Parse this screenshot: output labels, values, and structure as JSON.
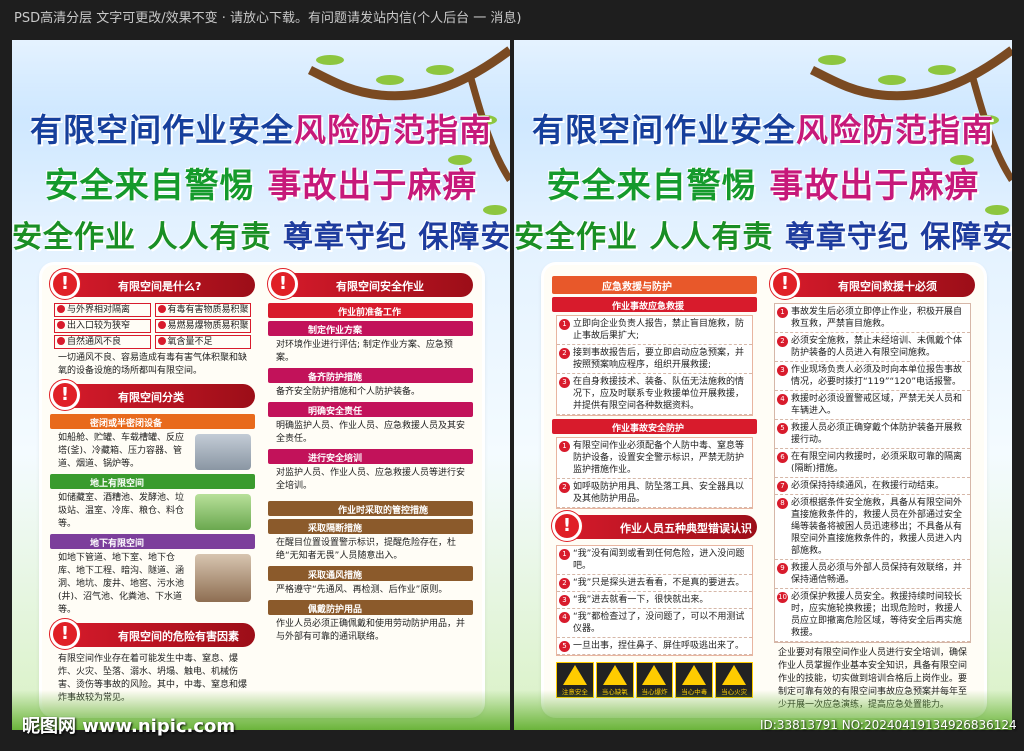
{
  "topbar": "PSD高清分层 文字可更改/效果不变 · 请放心下载。有问题请发站内信(个人后台 一 消息)",
  "headline": {
    "l1a": "有限空间作业安全",
    "l1b": "风险防范指南",
    "l2a": "安全来自警惕",
    "l2b": "事故出于麻痹",
    "l3a": "安全作业 人人有责",
    "l3b": "尊章守纪 保障安全"
  },
  "poster1": {
    "s1": {
      "title": "有限空间是什么?",
      "cells": [
        "与外界相对隔离",
        "有毒有害物质易积聚",
        "出入口较为狭窄",
        "易燃易爆物质易积聚",
        "自然通风不良",
        "氧含量不足"
      ],
      "desc": "一切通风不良、容易造成有毒有害气体积聚和缺氧的设备设施的场所都叫有限空间。"
    },
    "s2": {
      "title": "有限空间分类",
      "sub1": "密闭或半密闭设备",
      "t1": "如船舱、贮罐、车载槽罐、反应塔(釜)、冷藏箱、压力容器、管道、烟道、锅炉等。",
      "sub2": "地上有限空间",
      "t2": "如储藏室、酒糟池、发酵池、垃圾站、温室、冷库、粮仓、料仓等。",
      "sub3": "地下有限空间",
      "t3": "如地下管道、地下室、地下仓库、地下工程、暗沟、隧道、涵洞、地坑、废井、地窖、污水池(井)、沼气池、化粪池、下水道等。"
    },
    "s3": {
      "title": "有限空间的危险有害因素",
      "t": "有限空间作业存在着可能发生中毒、窒息、爆炸、火灾、坠落、溺水、坍塌、触电、机械伤害、烫伤等事故的风险。其中，中毒、窒息和爆炸事故较为常见。"
    },
    "s4": {
      "title": "有限空间安全作业",
      "sub0": "作业前准备工作",
      "sub1": "制定作业方案",
      "t1": "对环境作业进行评估; 制定作业方案、应急预案。",
      "sub2": "备齐防护措施",
      "t2": "备齐安全防护措施和个人防护装备。",
      "sub3": "明确安全责任",
      "t3": "明确监护人员、作业人员、应急救援人员及其安全责任。",
      "sub4": "进行安全培训",
      "t4": "对监护人员、作业人员、应急救援人员等进行安全培训。"
    },
    "s5": {
      "sub0": "作业时采取的管控措施",
      "sub1": "采取隔断措施",
      "t1": "在醒目位置设置警示标识，提醒危险存在，杜绝“无知者无畏”人员随意出入。",
      "sub2": "采取通风措施",
      "t2": "严格遵守“先通风、再检测、后作业”原则。",
      "sub3": "佩戴防护用品",
      "t3": "作业人员必须正确佩戴和使用劳动防护用品，并与外部有可靠的通讯联络。"
    }
  },
  "poster2": {
    "s1": {
      "title": "应急救援与防护",
      "sub1": "作业事故应急救援",
      "items1": [
        "立即向企业负责人报告，禁止盲目施救，防止事故后果扩大;",
        "接到事故报告后，要立即启动应急预案，并按照预案响应程序，组织开展救援;",
        "在自身救援技术、装备、队伍无法施救的情况下，应及时联系专业救援单位开展救援，并提供有限空间各种数据资料。"
      ],
      "sub2": "作业事故安全防护",
      "items2": [
        "有限空间作业必须配备个人防中毒、窒息等防护设备，设置安全警示标识，严禁无防护监护措施作业。",
        "如呼吸防护用具、防坠落工具、安全器具以及其他防护用品。"
      ]
    },
    "s2": {
      "title": "作业人员五种典型错误认识",
      "items": [
        "“我”没有闻到或看到任何危险，进入没问题吧。",
        "“我”只是探头进去看看，不是真的要进去。",
        "“我”进去就看一下，很快就出来。",
        "“我”都检查过了，没问题了，可以不用测试仪器。",
        "一旦出事，捏住鼻子、屏住呼吸逃出来了。"
      ],
      "warnings": [
        "注意安全",
        "当心缺氧",
        "当心爆炸",
        "当心中毒",
        "当心火灾"
      ]
    },
    "s3": {
      "title": "有限空间救援十必须",
      "items": [
        "事故发生后必须立即停止作业，积极开展自救互救，严禁盲目施救。",
        "必须安全施救，禁止未经培训、未佩戴个体防护装备的人员进入有限空间施救。",
        "作业现场负责人必须及时向本单位报告事故情况，必要时拨打“119”“120”电话报警。",
        "救援时必须设置警戒区域，严禁无关人员和车辆进入。",
        "救援人员必须正确穿戴个体防护装备开展救援行动。",
        "在有限空间内救援时，必须采取可靠的隔离(隔断)措施。",
        "必须保持持续通风，在救援行动结束。",
        "必须根据条件安全施救，具备从有限空间外直接施救条件的，救援人员在外部通过安全绳等装备将被困人员迅速移出；不具备从有限空间外直接施救条件的，救援人员进入内部施救。",
        "救援人员必须与外部人员保持有效联络，并保持通信畅通。",
        "必须保护救援人员安全。救援持续时间较长时，应实施轮换救援；出现危险时，救援人员应立即撤离危险区域，等待安全后再实施救援。"
      ],
      "closing": "企业要对有限空间作业人员进行安全培训，确保作业人员掌握作业基本安全知识，具备有限空间作业的技能，切实做到培训合格后上岗作业。要制定可靠有效的有限空间事故应急预案并每年至少开展一次应急演练，提高应急处置能力。"
    }
  },
  "footer": {
    "watermark": "昵图网 www.nipic.com",
    "id": "ID:33813791 NO:20240419134926836124"
  }
}
